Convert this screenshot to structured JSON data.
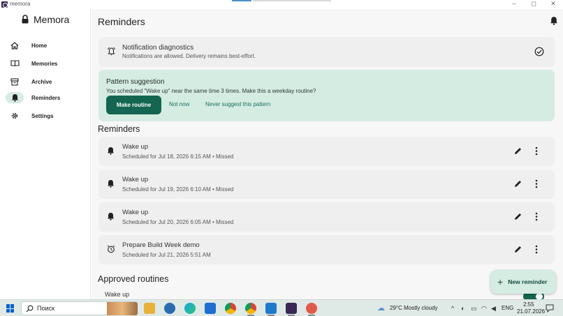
{
  "window": {
    "title": "memora",
    "controls": {
      "minimize": "–",
      "maximize": "◻",
      "close": "✕"
    }
  },
  "sidebar": {
    "brand": "Memora",
    "items": [
      {
        "label": "Home",
        "icon": "home-icon"
      },
      {
        "label": "Memories",
        "icon": "book-icon"
      },
      {
        "label": "Archive",
        "icon": "archive-icon"
      },
      {
        "label": "Reminders",
        "icon": "bell-icon",
        "active": true
      },
      {
        "label": "Settings",
        "icon": "gear-icon"
      }
    ]
  },
  "main": {
    "title": "Reminders",
    "diagnostics": {
      "title": "Notification diagnostics",
      "subtitle": "Notifications are allowed. Delivery remains best-effort."
    },
    "pattern": {
      "title": "Pattern suggestion",
      "text": "You scheduled \"Wake up\" near the same time 3 times. Make this a weekday routine?",
      "primary": "Make routine",
      "secondary": "Not now",
      "tertiary": "Never suggest this pattern"
    },
    "reminders_title": "Reminders",
    "reminders": [
      {
        "title": "Wake up",
        "subtitle": "Scheduled for Jul 18, 2026 6:15 AM • Missed",
        "icon": "bell-icon"
      },
      {
        "title": "Wake up",
        "subtitle": "Scheduled for Jul 19, 2026 6:10 AM • Missed",
        "icon": "bell-icon"
      },
      {
        "title": "Wake up",
        "subtitle": "Scheduled for Jul 20, 2026 6:05 AM • Missed",
        "icon": "bell-icon"
      },
      {
        "title": "Prepare Build Week demo",
        "subtitle": "Scheduled for Jul 21, 2026 5:51 AM",
        "icon": "alarm-clock-icon"
      }
    ],
    "routines_title": "Approved routines",
    "routines": [
      {
        "name": "Wake up",
        "enabled": true
      }
    ],
    "fab": {
      "plus": "+",
      "label": "New reminder"
    }
  },
  "taskbar": {
    "search_placeholder": "Поиск",
    "weather": "29°C  Mostly cloudy",
    "lang": "ENG",
    "time": "2:55",
    "date": "21.07.2026"
  },
  "colors": {
    "accent": "#146650",
    "suggestion_bg": "#d5ece3",
    "card_bg": "#efefef"
  }
}
